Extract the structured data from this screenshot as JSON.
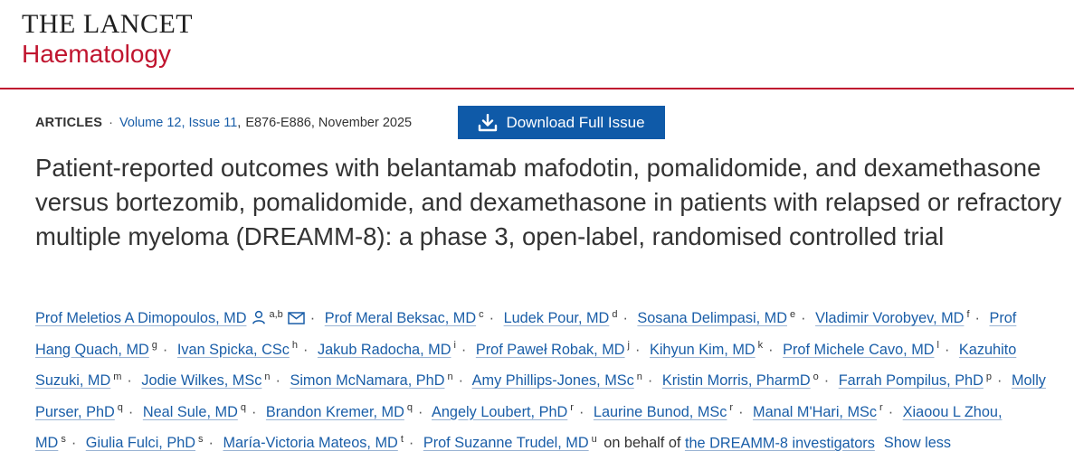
{
  "journal": {
    "brand_main": "THE LANCET",
    "brand_sub": "Haematology"
  },
  "article_meta": {
    "type": "ARTICLES",
    "issue_link": "Volume 12, Issue 11",
    "pages_date": "E876-E886, November 2025"
  },
  "download_button": {
    "label": "Download Full Issue",
    "icon": "download-icon"
  },
  "title": "Patient-reported outcomes with belantamab mafodotin, pomalidomide, and dexamethasone versus bortezomib, pomalidomide, and dexamethasone in patients with relapsed or refractory multiple myeloma (DREAMM-8): a phase 3, open-label, randomised controlled trial",
  "authors": [
    {
      "name": "Prof Meletios A Dimopoulos, MD",
      "aff": "a,b"
    },
    {
      "name": "Prof Meral Beksac, MD",
      "aff": "c"
    },
    {
      "name": "Ludek Pour, MD",
      "aff": "d"
    },
    {
      "name": "Sosana Delimpasi, MD",
      "aff": "e"
    },
    {
      "name": "Vladimir Vorobyev, MD",
      "aff": "f"
    },
    {
      "name": "Prof Hang Quach, MD",
      "aff": "g"
    },
    {
      "name": "Ivan Spicka, CSc",
      "aff": "h"
    },
    {
      "name": "Jakub Radocha, MD",
      "aff": "i"
    },
    {
      "name": "Prof Paweł Robak, MD",
      "aff": "j"
    },
    {
      "name": "Kihyun Kim, MD",
      "aff": "k"
    },
    {
      "name": "Prof Michele Cavo, MD",
      "aff": "l"
    },
    {
      "name": "Kazuhito Suzuki, MD",
      "aff": "m"
    },
    {
      "name": "Jodie Wilkes, MSc",
      "aff": "n"
    },
    {
      "name": "Simon McNamara, PhD",
      "aff": "n"
    },
    {
      "name": "Amy Phillips-Jones, MSc",
      "aff": "n"
    },
    {
      "name": "Kristin Morris, PharmD",
      "aff": "o"
    },
    {
      "name": "Farrah Pompilus, PhD",
      "aff": "p"
    },
    {
      "name": "Molly Purser, PhD",
      "aff": "q"
    },
    {
      "name": "Neal Sule, MD",
      "aff": "q"
    },
    {
      "name": "Brandon Kremer, MD",
      "aff": "q"
    },
    {
      "name": "Angely Loubert, PhD",
      "aff": "r"
    },
    {
      "name": "Laurine Bunod, MSc",
      "aff": "r"
    },
    {
      "name": "Manal M'Hari, MSc",
      "aff": "r"
    },
    {
      "name": "Xiaoou L Zhou, MD",
      "aff": "s"
    },
    {
      "name": "Giulia Fulci, PhD",
      "aff": "s"
    },
    {
      "name": "María-Victoria Mateos, MD",
      "aff": "t"
    },
    {
      "name": "Prof Suzanne Trudel, MD",
      "aff": "u"
    }
  ],
  "on_behalf_text": "on behalf of",
  "group_link": "the DREAMM-8 investigators",
  "show_less_label": "Show less",
  "separator": "·",
  "icons": {
    "first_author": [
      "person-icon",
      "mail-icon"
    ]
  },
  "colors": {
    "brand_red": "#c0152f",
    "link_blue": "#1a5ea8",
    "button_blue": "#0f5aa8"
  }
}
